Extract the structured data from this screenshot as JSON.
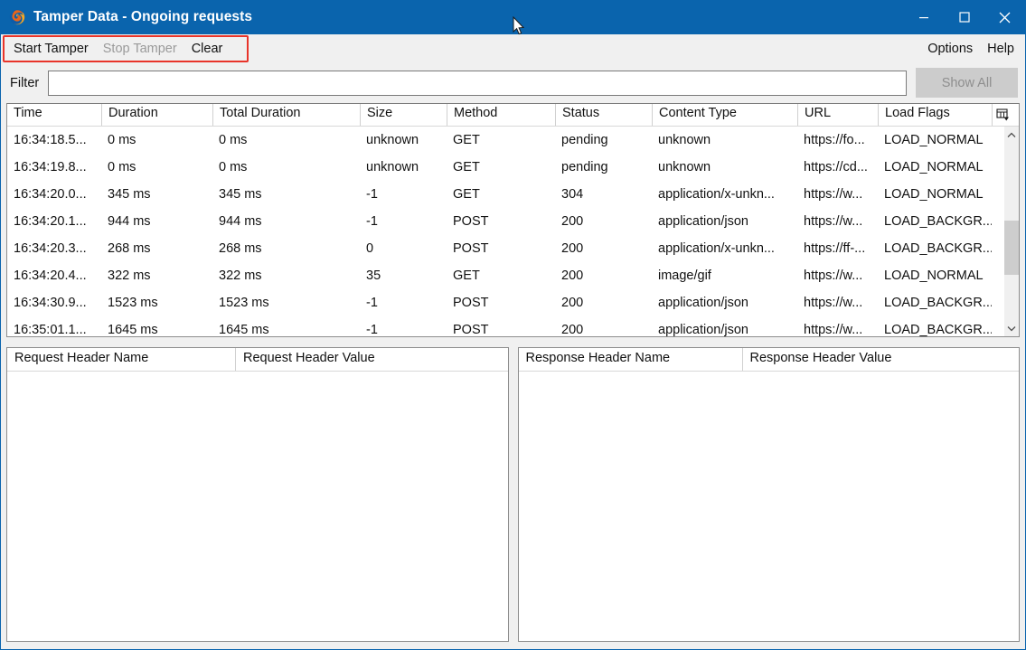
{
  "window": {
    "title": "Tamper Data - Ongoing requests",
    "app_icon": "firefox-icon",
    "titlebar_color": "#0a64ad",
    "annotation_color": "#e8342a",
    "controls": {
      "minimize": "minimize-icon",
      "maximize": "maximize-icon",
      "close": "close-icon"
    }
  },
  "menubar": {
    "left_items": [
      {
        "label": "Start Tamper",
        "enabled": true
      },
      {
        "label": "Stop Tamper",
        "enabled": false
      },
      {
        "label": "Clear",
        "enabled": true
      }
    ],
    "right_items": [
      {
        "label": "Options",
        "enabled": true
      },
      {
        "label": "Help",
        "enabled": true
      }
    ]
  },
  "filter": {
    "label": "Filter",
    "value": "",
    "placeholder": "",
    "show_all_label": "Show All",
    "show_all_enabled": false
  },
  "requests_table": {
    "columns": [
      "Time",
      "Duration",
      "Total Duration",
      "Size",
      "Method",
      "Status",
      "Content Type",
      "URL",
      "Load Flags"
    ],
    "column_picker_icon": "column-chooser-icon",
    "rows": [
      {
        "time": "16:34:18.5...",
        "duration": "0 ms",
        "total_duration": "0 ms",
        "size": "unknown",
        "method": "GET",
        "status": "pending",
        "content_type": "unknown",
        "url": "https://fo...",
        "load_flags": "LOAD_NORMAL"
      },
      {
        "time": "16:34:19.8...",
        "duration": "0 ms",
        "total_duration": "0 ms",
        "size": "unknown",
        "method": "GET",
        "status": "pending",
        "content_type": "unknown",
        "url": "https://cd...",
        "load_flags": "LOAD_NORMAL"
      },
      {
        "time": "16:34:20.0...",
        "duration": "345 ms",
        "total_duration": "345 ms",
        "size": "-1",
        "method": "GET",
        "status": "304",
        "content_type": "application/x-unkn...",
        "url": "https://w...",
        "load_flags": "LOAD_NORMAL"
      },
      {
        "time": "16:34:20.1...",
        "duration": "944 ms",
        "total_duration": "944 ms",
        "size": "-1",
        "method": "POST",
        "status": "200",
        "content_type": "application/json",
        "url": "https://w...",
        "load_flags": "LOAD_BACKGR..."
      },
      {
        "time": "16:34:20.3...",
        "duration": "268 ms",
        "total_duration": "268 ms",
        "size": "0",
        "method": "POST",
        "status": "200",
        "content_type": "application/x-unkn...",
        "url": "https://ff-...",
        "load_flags": "LOAD_BACKGR..."
      },
      {
        "time": "16:34:20.4...",
        "duration": "322 ms",
        "total_duration": "322 ms",
        "size": "35",
        "method": "GET",
        "status": "200",
        "content_type": "image/gif",
        "url": "https://w...",
        "load_flags": "LOAD_NORMAL"
      },
      {
        "time": "16:34:30.9...",
        "duration": "1523 ms",
        "total_duration": "1523 ms",
        "size": "-1",
        "method": "POST",
        "status": "200",
        "content_type": "application/json",
        "url": "https://w...",
        "load_flags": "LOAD_BACKGR..."
      },
      {
        "time": "16:35:01.1...",
        "duration": "1645 ms",
        "total_duration": "1645 ms",
        "size": "-1",
        "method": "POST",
        "status": "200",
        "content_type": "application/json",
        "url": "https://w...",
        "load_flags": "LOAD_BACKGR..."
      }
    ]
  },
  "request_headers_panel": {
    "columns": [
      "Request Header Name",
      "Request Header Value"
    ],
    "rows": []
  },
  "response_headers_panel": {
    "columns": [
      "Response Header Name",
      "Response Header Value"
    ],
    "rows": []
  }
}
